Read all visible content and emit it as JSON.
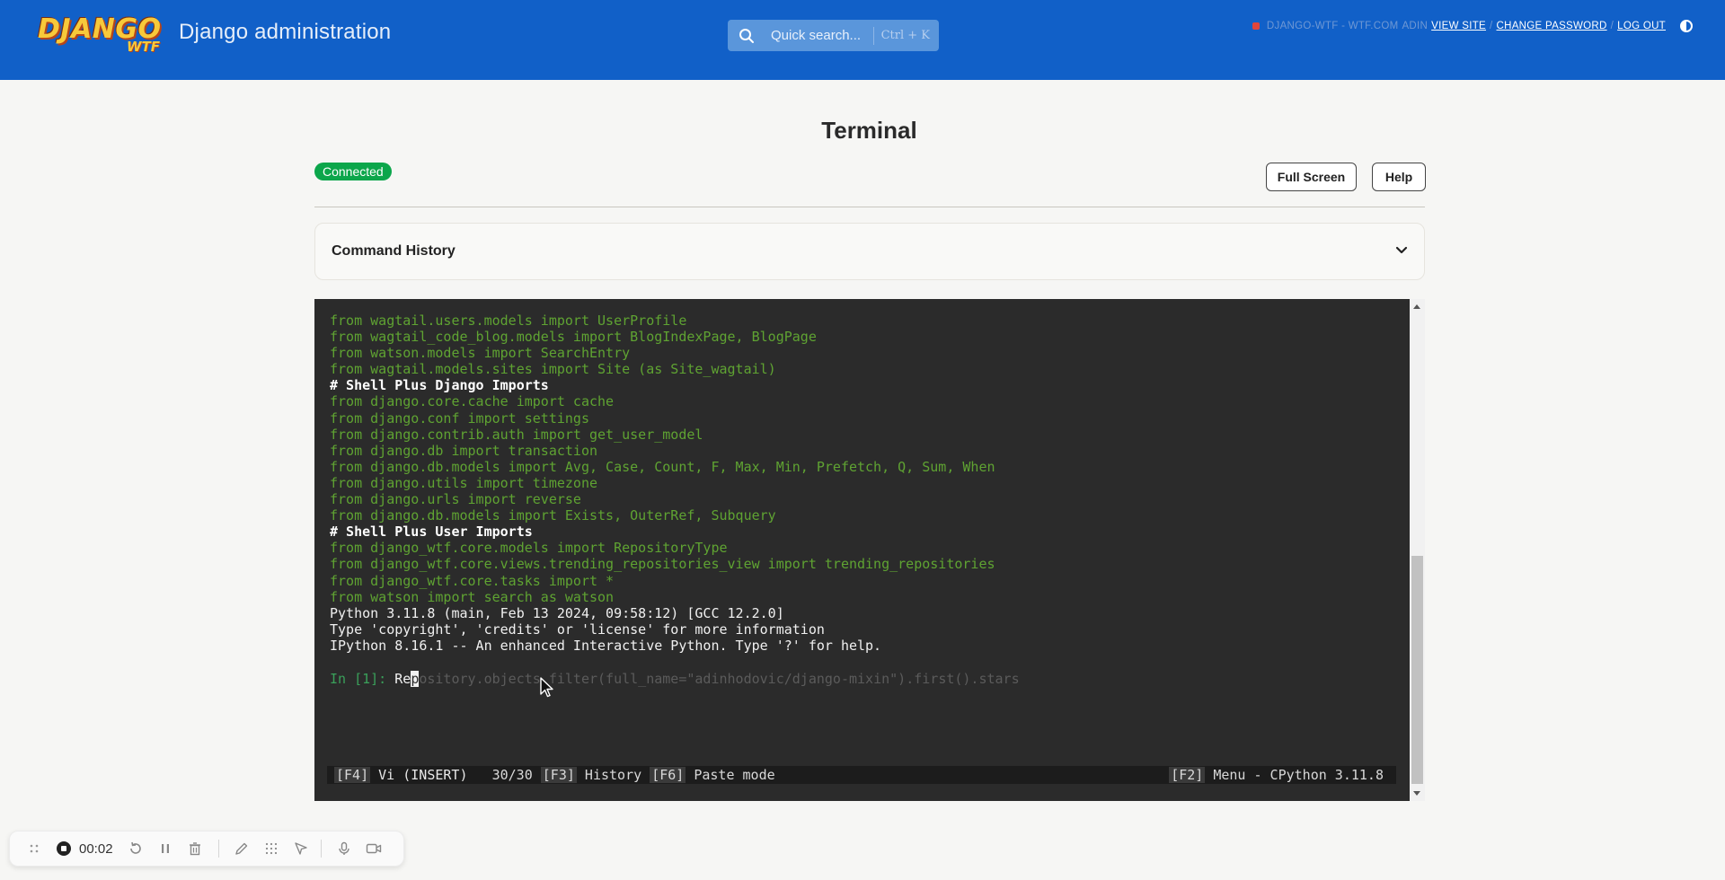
{
  "header": {
    "logo_main": "DJANGO",
    "logo_sub": "WTF",
    "site_title": "Django administration",
    "search": {
      "placeholder": "Quick search...",
      "shortcut": "Ctrl + K",
      "icon": "search-icon"
    },
    "user_tools": {
      "site_label": "DJANGO-WTF - WTF.COM",
      "user": "ADIN",
      "view_site": "VIEW SITE",
      "change_password": "CHANGE PASSWORD",
      "log_out": "LOG OUT",
      "separator": "/"
    }
  },
  "main": {
    "title": "Terminal",
    "status": "Connected",
    "buttons": {
      "full_screen": "Full Screen",
      "help": "Help"
    },
    "command_history_label": "Command History"
  },
  "terminal": {
    "lines": [
      {
        "text": "from wagtail.users.models import UserProfile",
        "style": "green"
      },
      {
        "text": "from wagtail_code_blog.models import BlogIndexPage, BlogPage",
        "style": "green"
      },
      {
        "text": "from watson.models import SearchEntry",
        "style": "green"
      },
      {
        "text": "from wagtail.models.sites import Site (as Site_wagtail)",
        "style": "green"
      },
      {
        "text": "# Shell Plus Django Imports",
        "style": "bold"
      },
      {
        "text": "from django.core.cache import cache",
        "style": "green"
      },
      {
        "text": "from django.conf import settings",
        "style": "green"
      },
      {
        "text": "from django.contrib.auth import get_user_model",
        "style": "green"
      },
      {
        "text": "from django.db import transaction",
        "style": "green"
      },
      {
        "text": "from django.db.models import Avg, Case, Count, F, Max, Min, Prefetch, Q, Sum, When",
        "style": "green"
      },
      {
        "text": "from django.utils import timezone",
        "style": "green"
      },
      {
        "text": "from django.urls import reverse",
        "style": "green"
      },
      {
        "text": "from django.db.models import Exists, OuterRef, Subquery",
        "style": "green"
      },
      {
        "text": "# Shell Plus User Imports",
        "style": "bold"
      },
      {
        "text": "from django_wtf.core.models import RepositoryType",
        "style": "green"
      },
      {
        "text": "from django_wtf.core.views.trending_repositories_view import trending_repositories",
        "style": "green"
      },
      {
        "text": "from django_wtf.core.tasks import *",
        "style": "green"
      },
      {
        "text": "from watson import search as watson",
        "style": "green"
      },
      {
        "text": "Python 3.11.8 (main, Feb 13 2024, 09:58:12) [GCC 12.2.0]",
        "style": "white"
      },
      {
        "text": "Type 'copyright', 'credits' or 'license' for more information",
        "style": "white"
      },
      {
        "text": "IPython 8.16.1 -- An enhanced Interactive Python. Type '?' for help.",
        "style": "white"
      }
    ],
    "prompt": {
      "in_label": "In [1]: ",
      "typed": "Re",
      "cursor_char": "p",
      "suggestion": "ository.objects.filter(full_name=\"adinhodovic/django-mixin\").first().stars"
    },
    "statusbar": {
      "mode_key": "[F4]",
      "mode": " Vi (INSERT)",
      "count": "30/30",
      "history_key": "[F3]",
      "history": " History",
      "paste_key": "[F6]",
      "paste": " Paste mode",
      "menu_key": "[F2]",
      "menu": " Menu - CPython 3.11.8"
    }
  },
  "recorder": {
    "timer": "00:02"
  },
  "colors": {
    "header_bg": "#1160c8",
    "badge_green": "#0ca64b",
    "terminal_bg": "#2b2b2b",
    "terminal_green": "#5fa332"
  }
}
